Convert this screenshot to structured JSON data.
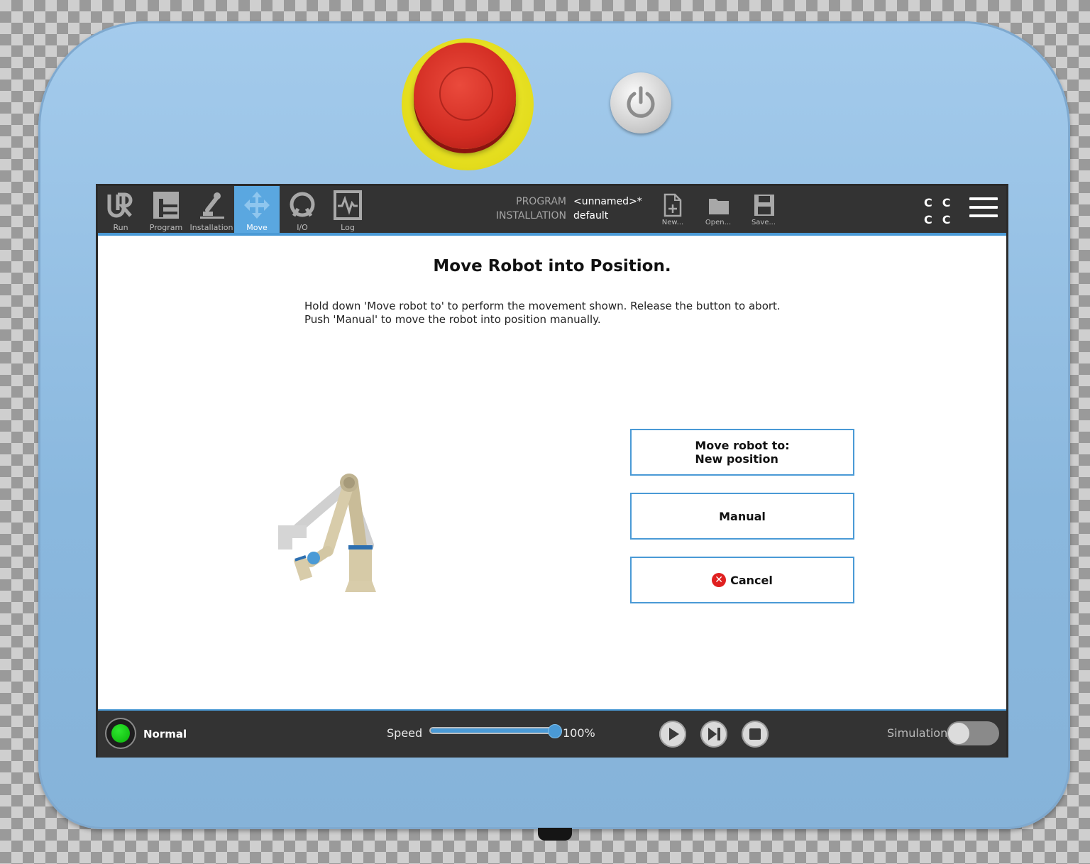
{
  "nav": {
    "tabs": [
      {
        "label": "Run",
        "icon": "ur-logo-icon"
      },
      {
        "label": "Program",
        "icon": "program-icon"
      },
      {
        "label": "Installation",
        "icon": "robot-arm-icon"
      },
      {
        "label": "Move",
        "icon": "move-arrows-icon",
        "active": true
      },
      {
        "label": "I/O",
        "icon": "io-icon"
      },
      {
        "label": "Log",
        "icon": "log-icon"
      }
    ]
  },
  "program_info": {
    "program_key": "PROGRAM",
    "program_value": "<unnamed>*",
    "installation_key": "INSTALLATION",
    "installation_value": "default"
  },
  "file_actions": {
    "new_label": "New...",
    "open_label": "Open...",
    "save_label": "Save..."
  },
  "cc_indicator": {
    "row1": "CC",
    "row2": "CC"
  },
  "dialog": {
    "title": "Move Robot into Position.",
    "line1": "Hold down 'Move robot to' to perform the movement shown. Release the button to abort.",
    "line2": "Push 'Manual' to move the robot into position manually.",
    "move_line1": "Move robot to:",
    "move_line2": "New position",
    "manual_label": "Manual",
    "cancel_label": "Cancel"
  },
  "status": {
    "label": "Normal",
    "color": "#0ab20a"
  },
  "speed": {
    "label": "Speed",
    "value_text": "100%",
    "fraction": 1.0
  },
  "simulation": {
    "label": "Simulation",
    "enabled": false
  },
  "colors": {
    "accent": "#4a9ad6",
    "bar": "#333333",
    "estop": "#d22c22",
    "estop_ring": "#e3dc1c"
  }
}
